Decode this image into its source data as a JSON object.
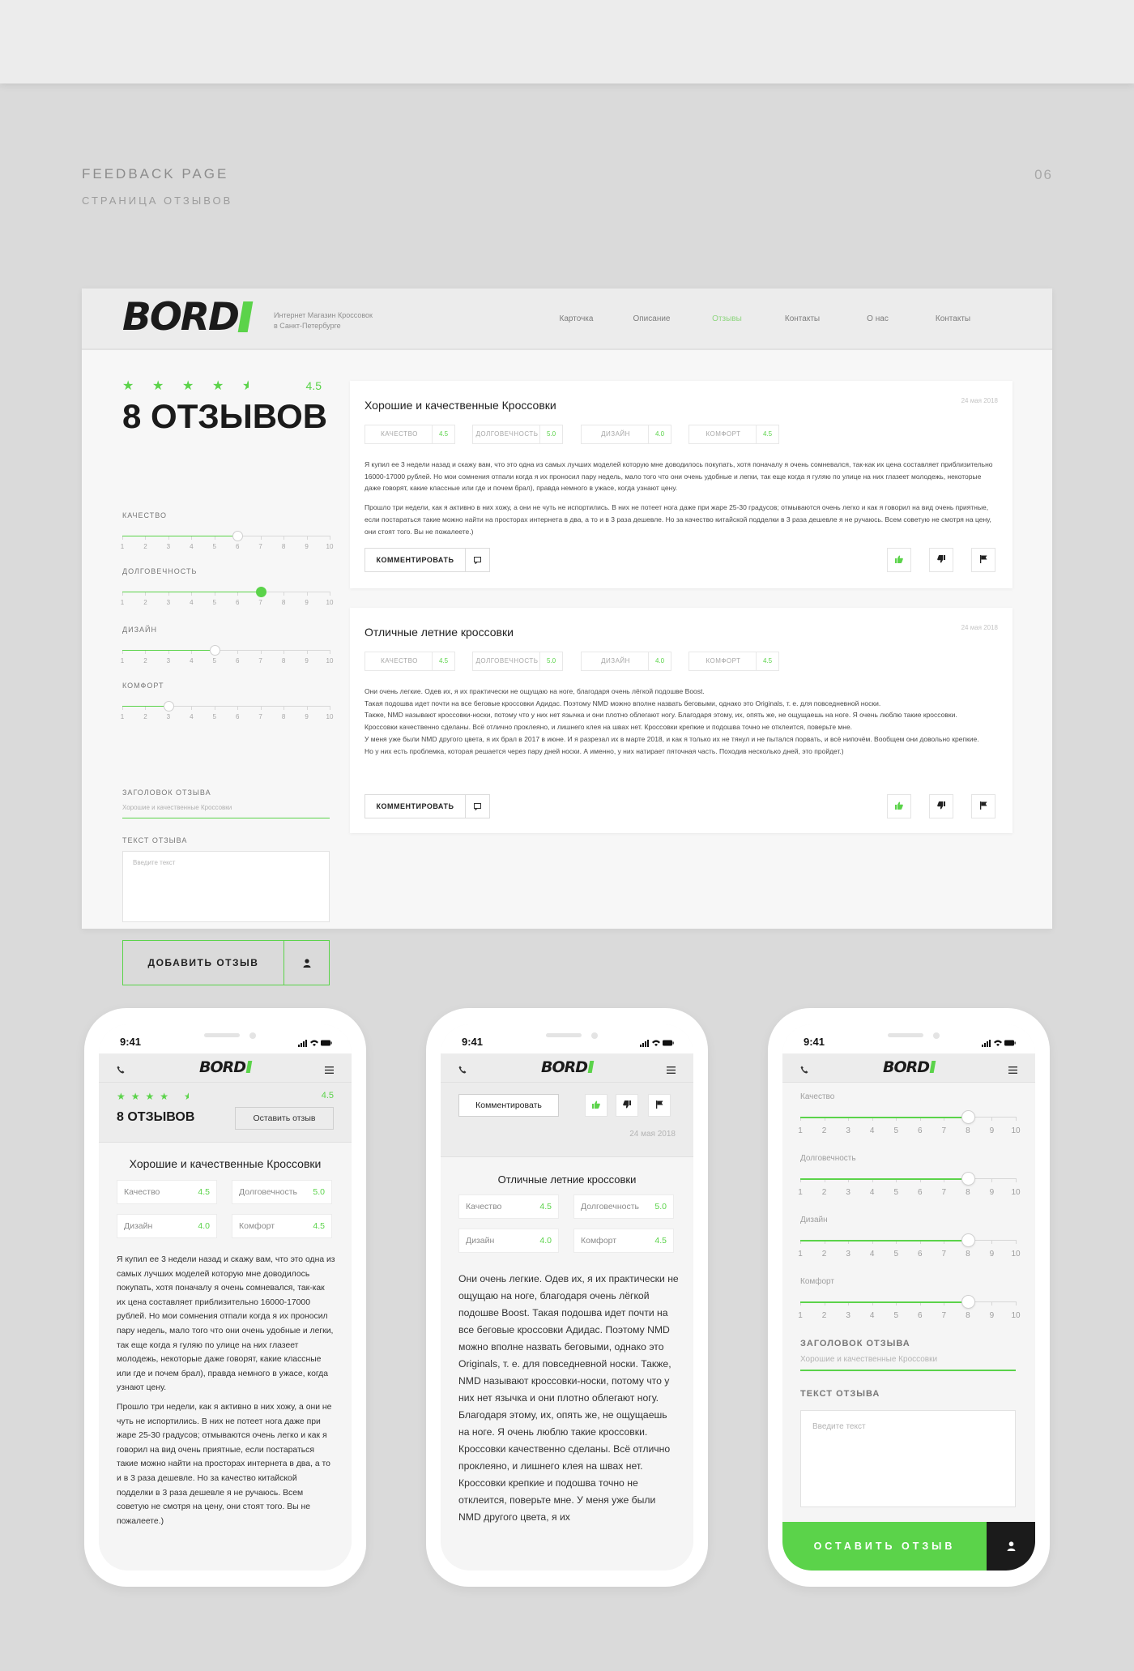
{
  "page": {
    "title": "FEEDBACK PAGE",
    "subtitle": "СТРАНИЦА ОТЗЫВОВ",
    "number": "06"
  },
  "colors": {
    "accent": "#5bd34a",
    "dark": "#1b1b1b",
    "background": "#dadada"
  },
  "brand": {
    "logo": "BORD",
    "tagline_line1": "Интернет Магазин Кроссовок",
    "tagline_line2": "в Санкт-Петербурге"
  },
  "nav": [
    "Карточка",
    "Описание",
    "Отзывы",
    "Контакты",
    "О нас",
    "Контакты"
  ],
  "nav_active_index": 2,
  "summary": {
    "stars": 4.5,
    "rating": "4.5",
    "count_text": "8 ОТЗЫВОВ"
  },
  "sliders": [
    {
      "label": "КАЧЕСТВО",
      "value": 6,
      "filled": false
    },
    {
      "label": "ДОЛГОВЕЧНОСТЬ",
      "value": 7,
      "filled": true
    },
    {
      "label": "ДИЗАЙН",
      "value": 5,
      "filled": false
    },
    {
      "label": "КОМФОРТ",
      "value": 3,
      "filled": false
    }
  ],
  "scale": [
    "1",
    "2",
    "3",
    "4",
    "5",
    "6",
    "7",
    "8",
    "9",
    "10"
  ],
  "form": {
    "title_label": "ЗАГОЛОВОК ОТЗЫВА",
    "title_placeholder": "Хорошие и качественные Кроссовки",
    "text_label": "ТЕКСТ ОТЗЫВА",
    "text_placeholder": "Введите текст",
    "submit_label": "ДОБАВИТЬ ОТЗЫВ"
  },
  "reviews": [
    {
      "title": "Хорошие и качественные Кроссовки",
      "date": "24 мая 2018",
      "metrics": [
        {
          "name": "КАЧЕСТВО",
          "value": "4.5"
        },
        {
          "name": "ДОЛГОВЕЧНОСТЬ",
          "value": "5.0"
        },
        {
          "name": "ДИЗАЙН",
          "value": "4.0"
        },
        {
          "name": "КОМФОРТ",
          "value": "4.5"
        }
      ],
      "paragraphs": [
        "Я купил ее 3 недели назад и скажу вам, что это одна из самых лучших моделей которую мне доводилось покупать, хотя поначалу я очень сомневался, так-как их цена составляет приблизительно 16000-17000 рублей. Но мои сомнения отпали когда я их проносил пару недель, мало того что они очень удобные и легки, так еще когда я гуляю по улице на них глазеет молодежь, некоторые даже говорят, какие классные или где и почем брал), правда немного в ужасе, когда узнают цену.",
        "Прошло три недели, как я активно в них хожу, а они не чуть не испортились. В них не потеет нога даже при жаре 25-30 градусов; отмываются очень легко и как я говорил на вид очень приятные, если постараться такие можно найти на просторах интернета в два, а то и в 3 раза дешевле. Но за качество китайской подделки в 3 раза дешевле я не ручаюсь. Всем советую не смотря на цену, они стоят того. Вы не пожалеете.)"
      ],
      "comment_label": "КОММЕНТИРОВАТЬ"
    },
    {
      "title": "Отличные летние кроссовки",
      "date": "24 мая 2018",
      "metrics": [
        {
          "name": "КАЧЕСТВО",
          "value": "4.5"
        },
        {
          "name": "ДОЛГОВЕЧНОСТЬ",
          "value": "5.0"
        },
        {
          "name": "ДИЗАЙН",
          "value": "4.0"
        },
        {
          "name": "КОМФОРТ",
          "value": "4.5"
        }
      ],
      "paragraphs": [
        "Они очень легкие. Одев их, я их практически не ощущаю на ноге, благодаря очень лёгкой подошве Boost.",
        "Такая подошва идет почти на все беговые кроссовки Адидас. Поэтому NMD можно вполне назвать беговыми, однако это Originals, т. е. для повседневной носки.",
        "Также, NMD называют кроссовки-носки, потому что у них нет язычка и они плотно облегают ногу. Благодаря этому, их, опять же, не ощущаешь на ноге. Я очень люблю такие кроссовки.",
        "Кроссовки качественно сделаны. Всё отлично проклеяно, и лишнего клея на швах нет. Кроссовки крепкие и подошва точно не отклеится, поверьте мне.",
        "У меня уже были NMD другого цвета, я их брал в 2017 в июне. И я разрезал их в марте 2018, и как я только их не тянул и не пытался порвать, и всё нипочём. Вообщем они довольно крепкие.",
        "Но у них есть проблемка, которая решается через пару дней носки. А именно, у них натирает пяточная часть. Походив несколько дней, это пройдет.)"
      ],
      "comment_label": "КОММЕНТИРОВАТЬ"
    }
  ],
  "mobile": {
    "time": "9:41",
    "logo": "BORD",
    "phone1": {
      "rating": "4.5",
      "count_text": "8 ОТЗЫВОВ",
      "leave_review": "Оставить отзыв",
      "title": "Хорошие и качественные Кроссовки",
      "metrics": [
        {
          "name": "Качество",
          "value": "4.5"
        },
        {
          "name": "Долговечность",
          "value": "5.0"
        },
        {
          "name": "Дизайн",
          "value": "4.0"
        },
        {
          "name": "Комфорт",
          "value": "4.5"
        }
      ],
      "paragraphs": [
        "Я купил ее 3 недели назад и скажу вам, что это одна из самых лучших моделей которую мне доводилось покупать, хотя поначалу я очень сомневался, так-как их цена составляет приблизительно 16000-17000 рублей. Но мои сомнения отпали когда я их проносил пару недель, мало того что они очень удобные и легки, так еще когда я гуляю по улице на них глазеет молодежь, некоторые даже говорят, какие классные или где и почем брал), правда немного в ужасе, когда узнают цену.",
        "Прошло три недели, как я активно в них хожу, а они не чуть не испортились. В них не потеет нога даже при жаре 25-30 градусов; отмываются очень легко и как я говорил на вид очень приятные, если постараться такие можно найти на просторах интернета в два, а то и в 3 раза дешевле. Но за качество китайской подделки в 3 раза дешевле я не ручаюсь. Всем советую не смотря на цену, они стоят того. Вы не пожалеете.)"
      ]
    },
    "phone2": {
      "comment_label": "Комментировать",
      "date": "24 мая 2018",
      "title": "Отличные летние кроссовки",
      "metrics": [
        {
          "name": "Качество",
          "value": "4.5"
        },
        {
          "name": "Долговечность",
          "value": "5.0"
        },
        {
          "name": "Дизайн",
          "value": "4.0"
        },
        {
          "name": "Комфорт",
          "value": "4.5"
        }
      ],
      "text": "Они очень легкие. Одев их, я их практически не ощущаю на ноге, благодаря очень лёгкой подошве Boost. Такая подошва идет почти на все беговые кроссовки Адидас. Поэтому NMD можно вполне назвать беговыми, однако это Originals, т. е. для повседневной носки. Также, NMD называют кроссовки-носки, потому что у них нет язычка и они плотно облегают ногу. Благодаря этому, их, опять же, не ощущаешь на ноге. Я очень люблю такие кроссовки. Кроссовки качественно сделаны. Всё отлично проклеяно, и лишнего клея на швах нет. Кроссовки крепкие и подошва точно не отклеится, поверьте мне. У меня уже были NMD другого цвета, я их"
    },
    "phone3": {
      "sliders": [
        {
          "label": "Качество",
          "value": 8
        },
        {
          "label": "Долговечность",
          "value": 8
        },
        {
          "label": "Дизайн",
          "value": 8
        },
        {
          "label": "Комфорт",
          "value": 8
        }
      ],
      "title_label": "ЗАГОЛОВОК ОТЗЫВА",
      "title_placeholder": "Хорошие и качественные Кроссовки",
      "text_label": "ТЕКСТ ОТЗЫВА",
      "text_placeholder": "Введите текст",
      "submit_label": "ОСТАВИТЬ ОТЗЫВ"
    }
  }
}
